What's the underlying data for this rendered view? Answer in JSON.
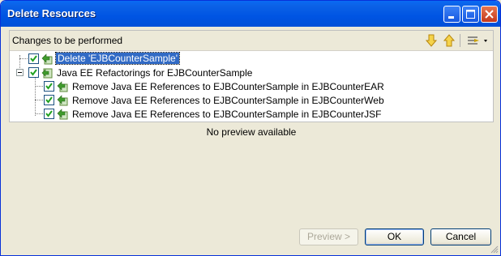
{
  "window": {
    "title": "Delete Resources",
    "buttons": {
      "minimize": "minimize",
      "maximize": "maximize",
      "close": "close"
    }
  },
  "changes_panel": {
    "title": "Changes to be performed",
    "toolbar": {
      "next_icon": "arrow-down-icon",
      "previous_icon": "arrow-up-icon",
      "filter_icon": "filter-icon"
    },
    "tree": [
      {
        "label": "Delete 'EJBCounterSample'",
        "checked": true,
        "selected": true,
        "level": 0
      },
      {
        "label": "Java EE Refactorings for EJBCounterSample",
        "checked": true,
        "selected": false,
        "level": 0,
        "expanded": true
      },
      {
        "label": "Remove Java EE References to EJBCounterSample in EJBCounterEAR",
        "checked": true,
        "level": 1
      },
      {
        "label": "Remove Java EE References to EJBCounterSample in EJBCounterWeb",
        "checked": true,
        "level": 1
      },
      {
        "label": "Remove Java EE References to EJBCounterSample in EJBCounterJSF",
        "checked": true,
        "level": 1
      }
    ]
  },
  "preview_message": "No preview available",
  "buttons": {
    "preview": "Preview >",
    "ok": "OK",
    "cancel": "Cancel"
  }
}
